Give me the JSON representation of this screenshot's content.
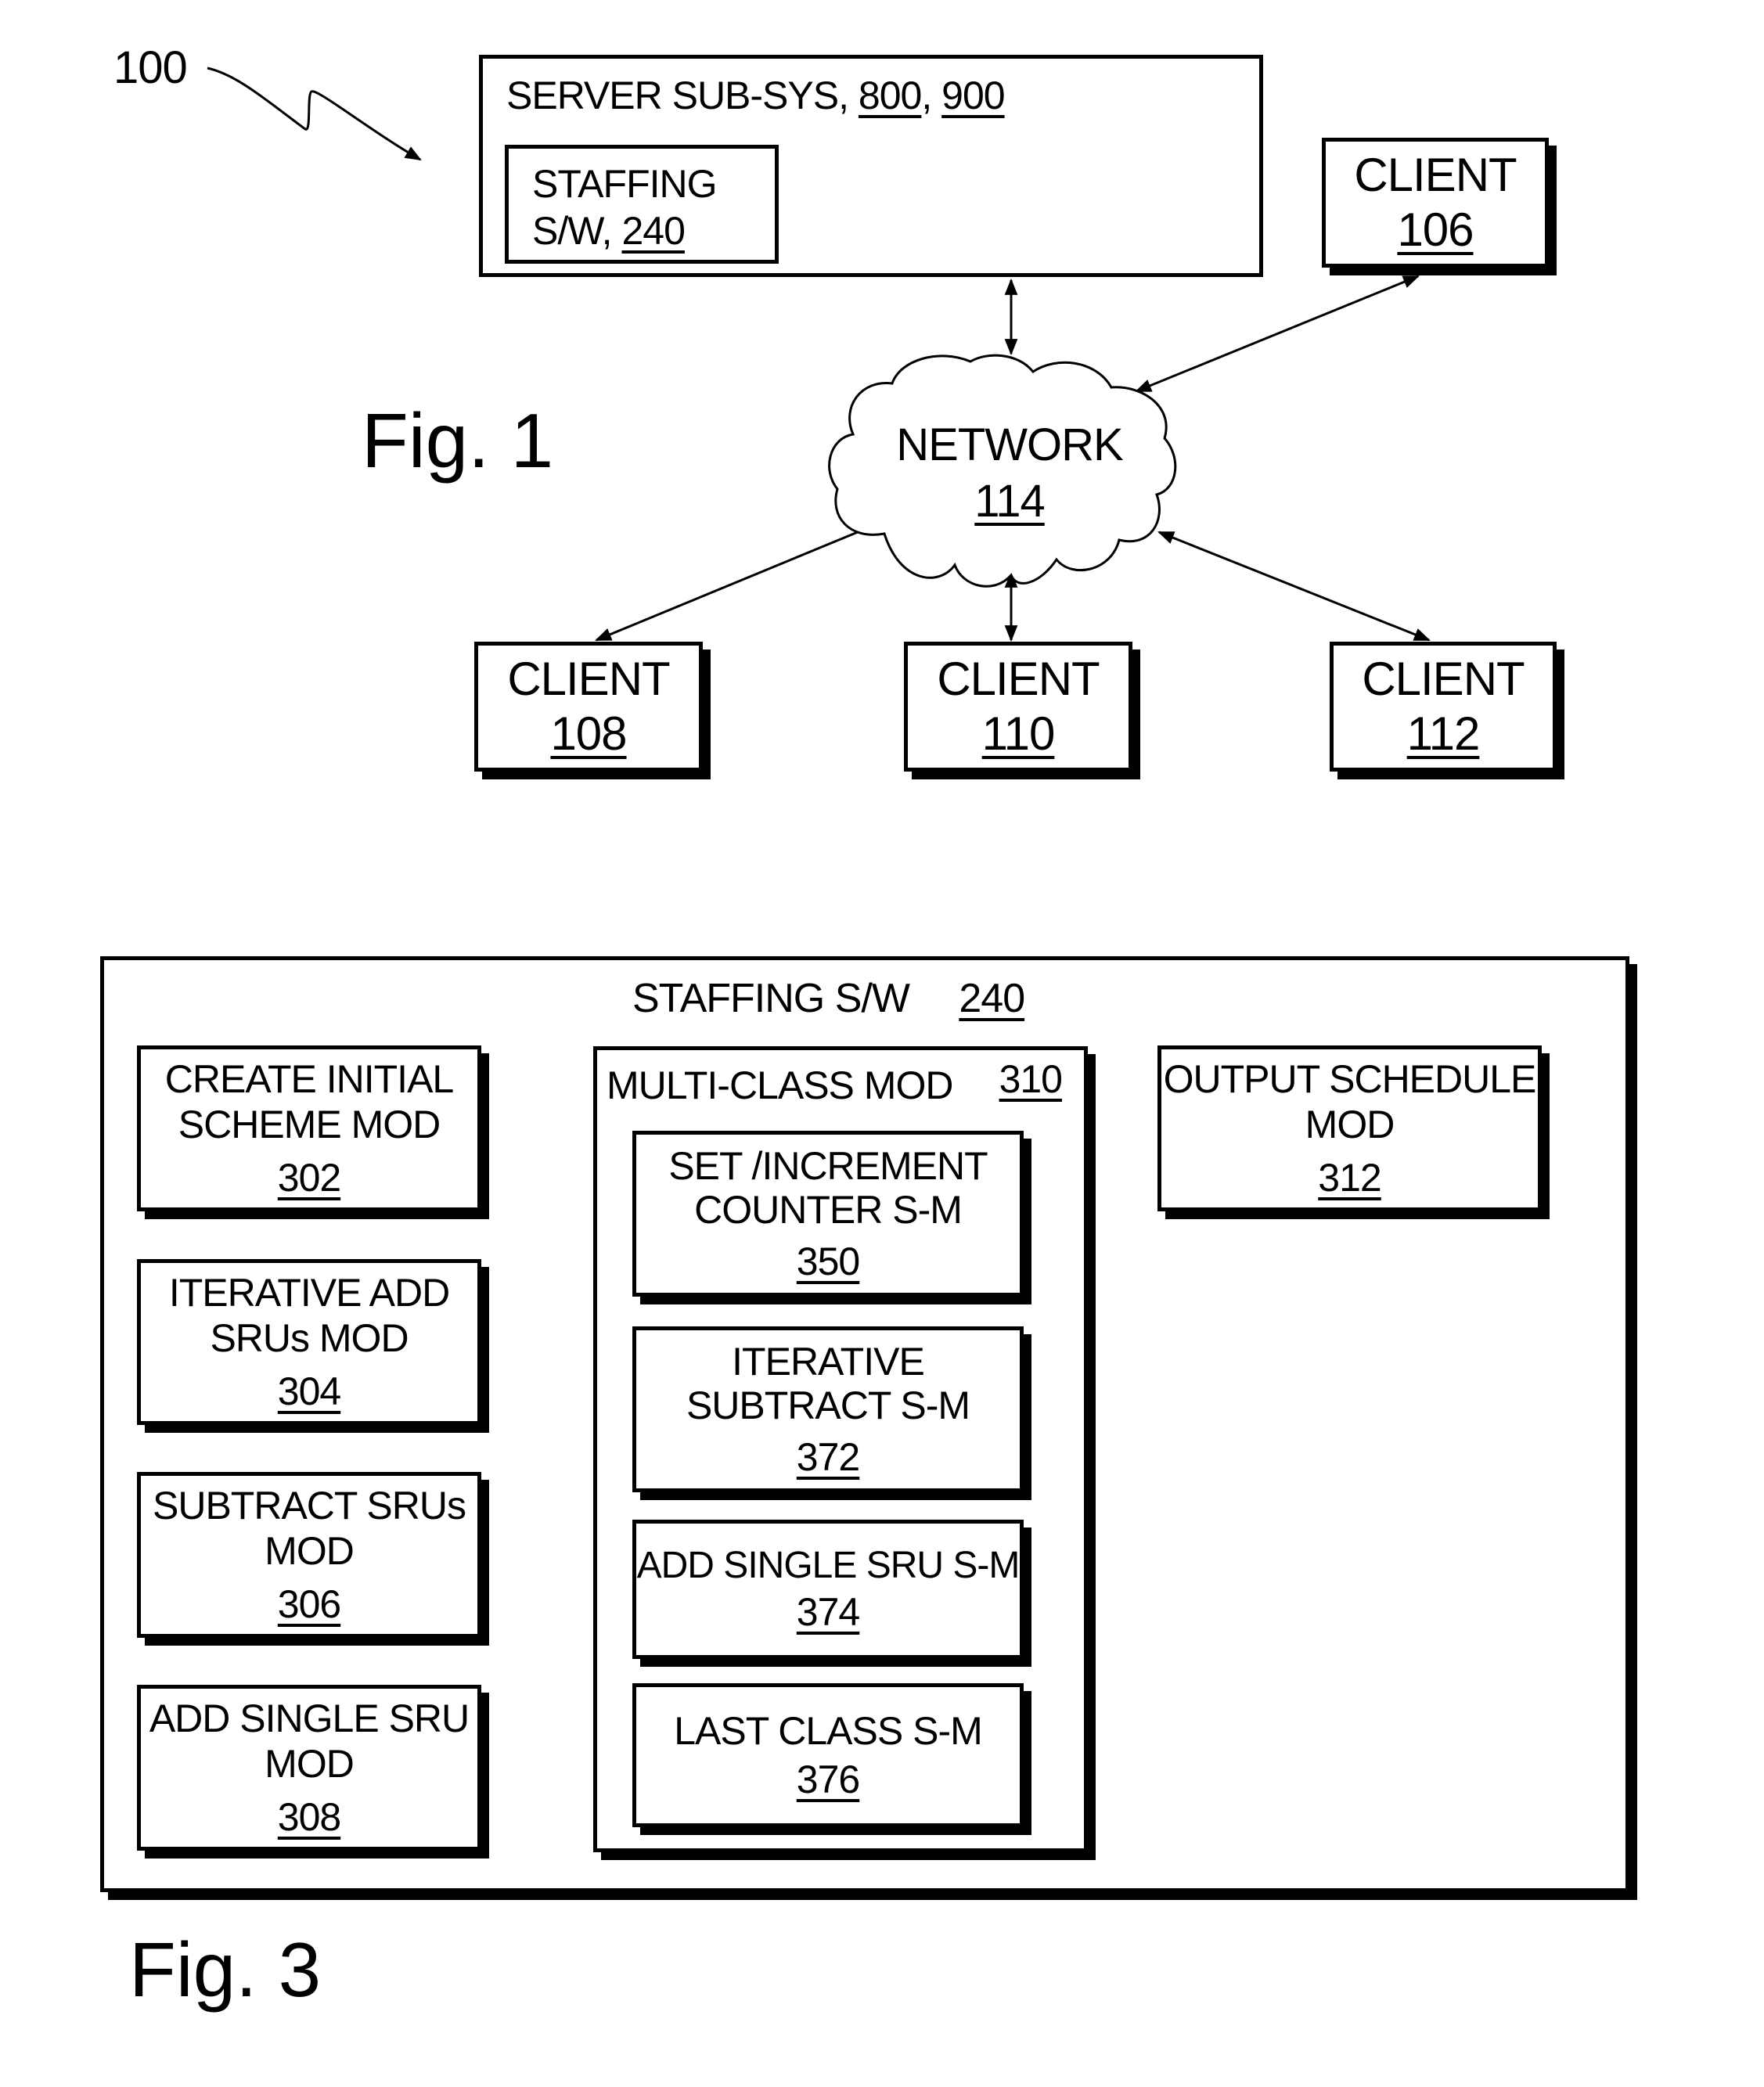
{
  "fig1": {
    "caption": "Fig. 1",
    "system_ref": "100",
    "server": {
      "label": "SERVER SUB-SYS,",
      "refs": [
        "800",
        "900"
      ],
      "inner": {
        "line1": "STAFFING",
        "line2": "S/W,",
        "ref": "240"
      }
    },
    "network": {
      "label": "NETWORK",
      "ref": "114"
    },
    "clients": [
      {
        "label": "CLIENT",
        "ref": "106"
      },
      {
        "label": "CLIENT",
        "ref": "108"
      },
      {
        "label": "CLIENT",
        "ref": "110"
      },
      {
        "label": "CLIENT",
        "ref": "112"
      }
    ]
  },
  "fig3": {
    "caption": "Fig. 3",
    "title": "STAFFING S/W",
    "title_ref": "240",
    "left_modules": [
      {
        "lines": [
          "CREATE INITIAL",
          "SCHEME MOD"
        ],
        "ref": "302"
      },
      {
        "lines": [
          "ITERATIVE ADD",
          "SRUs MOD"
        ],
        "ref": "304"
      },
      {
        "lines": [
          "SUBTRACT SRUs",
          "MOD"
        ],
        "ref": "306"
      },
      {
        "lines": [
          "ADD SINGLE SRU",
          "MOD"
        ],
        "ref": "308"
      }
    ],
    "multi_class": {
      "label": "MULTI-CLASS MOD",
      "ref": "310",
      "submodules": [
        {
          "lines": [
            "SET /INCREMENT",
            "COUNTER S-M"
          ],
          "ref": "350"
        },
        {
          "lines": [
            "ITERATIVE",
            "SUBTRACT S-M"
          ],
          "ref": "372"
        },
        {
          "lines": [
            "ADD SINGLE SRU S-M"
          ],
          "ref": "374"
        },
        {
          "lines": [
            "LAST CLASS S-M"
          ],
          "ref": "376"
        }
      ]
    },
    "output_module": {
      "lines": [
        "OUTPUT SCHEDULE",
        "MOD"
      ],
      "ref": "312"
    }
  }
}
